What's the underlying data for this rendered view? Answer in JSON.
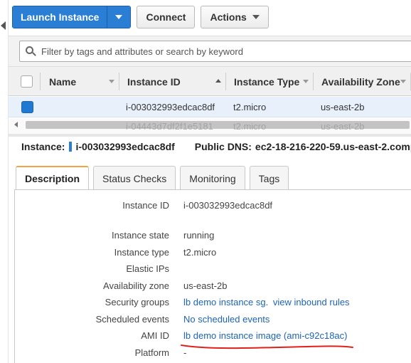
{
  "toolbar": {
    "launch_label": "Launch Instance",
    "connect_label": "Connect",
    "actions_label": "Actions"
  },
  "search": {
    "placeholder": "Filter by tags and attributes or search by keyword"
  },
  "grid": {
    "columns": [
      "Name",
      "Instance ID",
      "Instance Type",
      "Availability Zone"
    ],
    "rows": [
      {
        "name": "",
        "instance_id": "i-003032993edcac8df",
        "instance_type": "t2.micro",
        "zone": "us-east-2b",
        "selected": true
      },
      {
        "name": "",
        "instance_id": "i-04443d7df2f1e5181",
        "instance_type": "t2.micro",
        "zone": "us-east-2b",
        "selected": false
      }
    ]
  },
  "summary": {
    "instance_label": "Instance:",
    "instance_id": "i-003032993edcac8df",
    "dns_label": "Public DNS:",
    "dns_value": "ec2-18-216-220-59.us-east-2.comp"
  },
  "tabs": [
    "Description",
    "Status Checks",
    "Monitoring",
    "Tags"
  ],
  "details": {
    "instance_id": {
      "label": "Instance ID",
      "value": "i-003032993edcac8df"
    },
    "instance_state": {
      "label": "Instance state",
      "value": "running"
    },
    "instance_type": {
      "label": "Instance type",
      "value": "t2.micro"
    },
    "elastic_ips": {
      "label": "Elastic IPs",
      "value": ""
    },
    "availability_zone": {
      "label": "Availability zone",
      "value": "us-east-2b"
    },
    "security_groups": {
      "label": "Security groups",
      "group_link": "lb demo instance sg",
      "separator": ".",
      "rules_link": "view inbound rules"
    },
    "scheduled_events": {
      "label": "Scheduled events",
      "value": "No scheduled events"
    },
    "ami_id": {
      "label": "AMI ID",
      "value": "lb demo instance image (ami-c92c18ac)"
    },
    "platform": {
      "label": "Platform",
      "value": "-"
    }
  },
  "colors": {
    "primary_blue": "#2a7fd4",
    "link_blue": "#1e63b5",
    "selected_row": "#e8f1fb",
    "active_tab_accent": "#f1a442",
    "annotation_red": "#e0201c"
  }
}
